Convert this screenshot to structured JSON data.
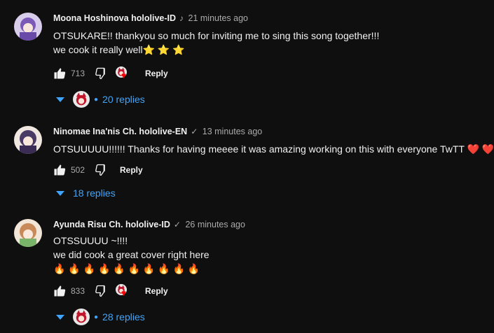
{
  "comments": [
    {
      "author": "Moona Hoshinova hololive-ID",
      "badge": "♪",
      "time": "21 minutes ago",
      "lines": [
        "OTSUKARE!! thankyou so much for inviting me to sing this song together!!!",
        "we cook it really well"
      ],
      "emoji": "⭐ ⭐ ⭐",
      "likes": "713",
      "reply_label": "Reply",
      "replies": "20 replies",
      "avatar_color": "#9b7fd4"
    },
    {
      "author": "Ninomae Ina'nis Ch. hololive-EN",
      "badge": "✓",
      "time": "13 minutes ago",
      "lines": [
        "OTSUUUUU!!!!!! Thanks for having meeee it was amazing working on this with everyone TwTT"
      ],
      "emoji": "❤️ ❤️",
      "likes": "502",
      "reply_label": "Reply",
      "replies": "18 replies",
      "avatar_color": "#5a4a7a"
    },
    {
      "author": "Ayunda Risu Ch. hololive-ID",
      "badge": "✓",
      "time": "26 minutes ago",
      "lines": [
        "OTSSUUUU ~!!!!",
        "we did cook a great cover right here"
      ],
      "emoji": "🔥 🔥 🔥 🔥 🔥 🔥 🔥 🔥 🔥 🔥",
      "likes": "833",
      "reply_label": "Reply",
      "replies": "28 replies",
      "avatar_color": "#d9a47a"
    }
  ],
  "colors": {
    "background": "#0f0f0f",
    "link": "#3ea6ff",
    "heart": "#ff0000"
  },
  "icons": [
    "like-icon",
    "dislike-icon",
    "heart-icon",
    "chevron-down-icon",
    "verified-icon",
    "music-note-icon"
  ]
}
